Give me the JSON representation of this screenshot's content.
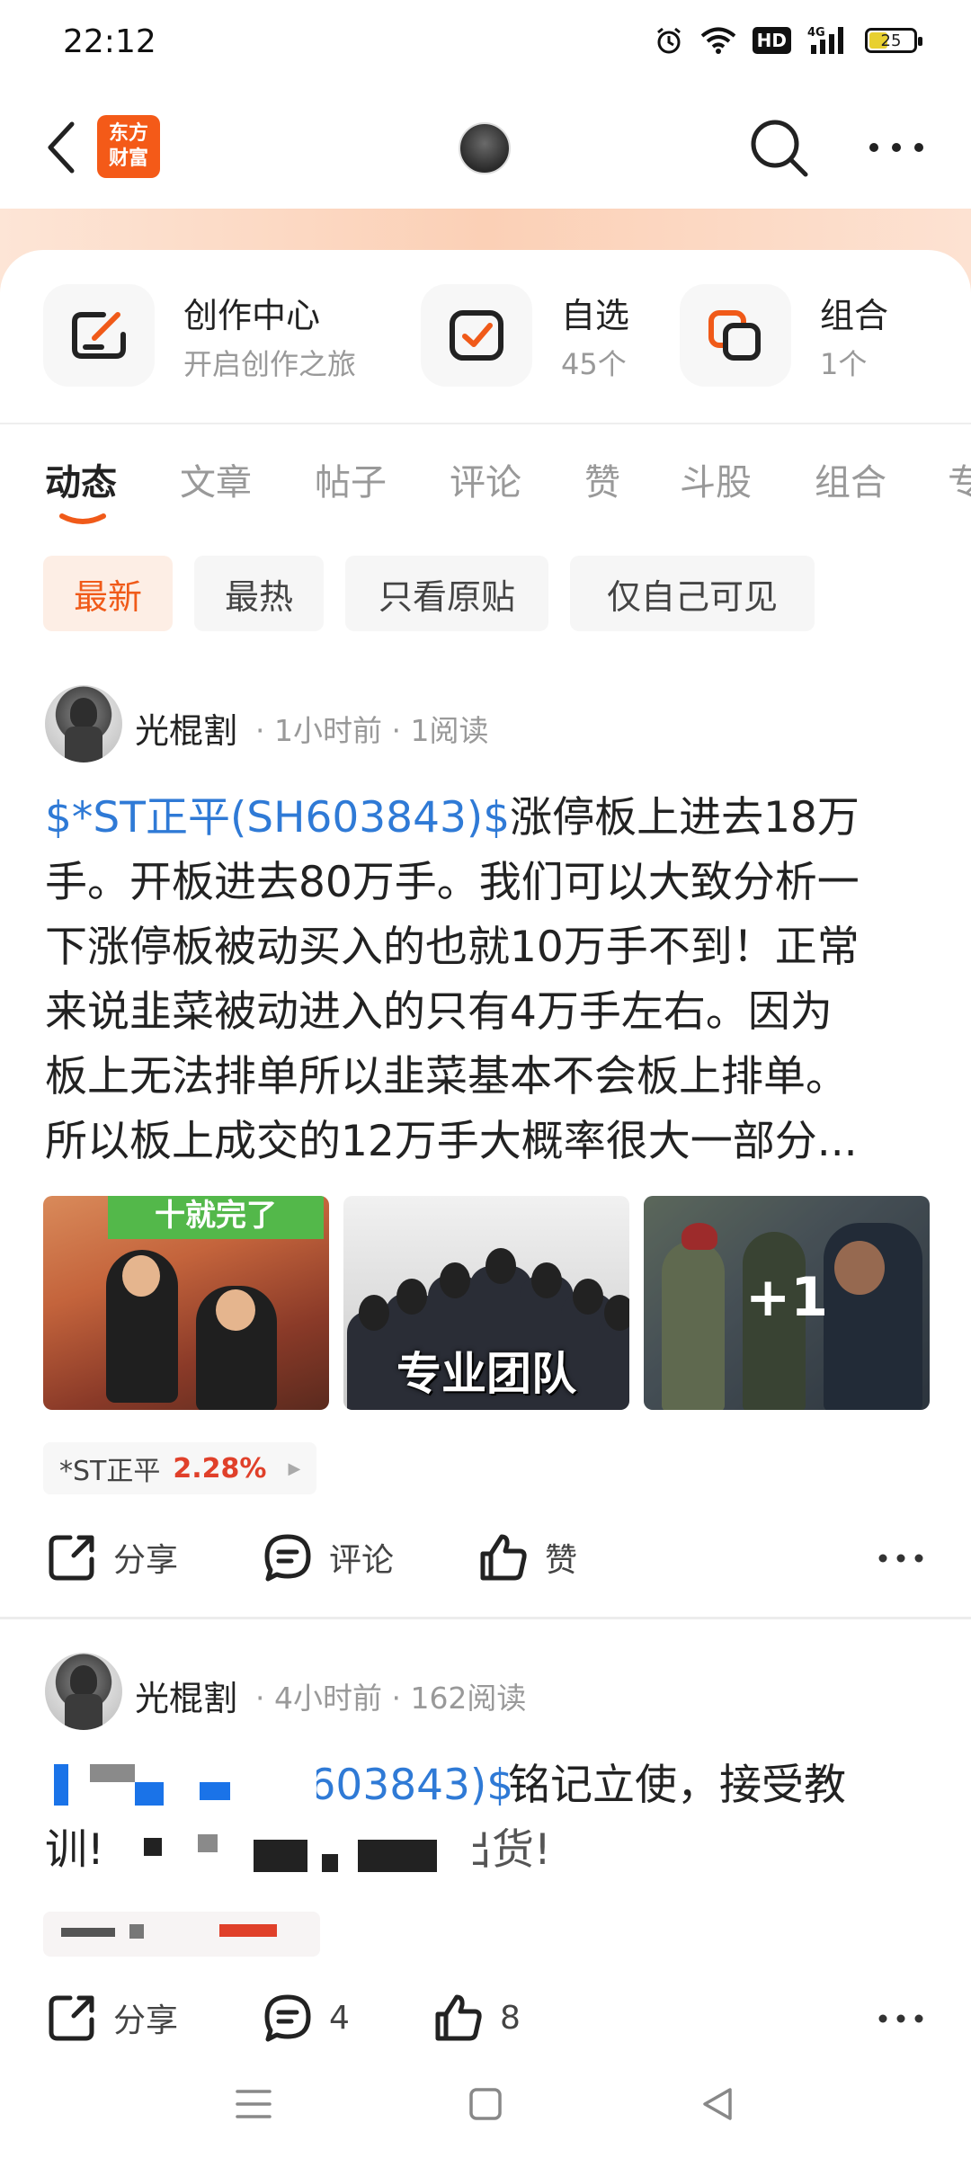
{
  "status_bar": {
    "time": "22:12",
    "hd": "HD",
    "network": "4G",
    "battery": "25"
  },
  "nav": {
    "logo_line1": "东方",
    "logo_line2": "财富",
    "back_icon": "chevron-left-icon",
    "search_icon": "search-icon",
    "more_icon": "more-horizontal-icon"
  },
  "quick": [
    {
      "title": "创作中心",
      "sub": "开启创作之旅",
      "icon": "edit-icon"
    },
    {
      "title": "自选",
      "sub": "45个",
      "icon": "checkbox-icon"
    },
    {
      "title": "组合",
      "sub": "1个",
      "icon": "portfolio-icon"
    }
  ],
  "tabs": [
    "动态",
    "文章",
    "帖子",
    "评论",
    "赞",
    "斗股",
    "组合",
    "专"
  ],
  "chips": [
    "最新",
    "最热",
    "只看原贴",
    "仅自己可见"
  ],
  "colors": {
    "accent": "#f05a19",
    "link": "#2f7ad6",
    "up": "#e0402a"
  },
  "post1": {
    "author": "光棍割",
    "meta": "· 1小时前 · 1阅读",
    "stock_link": "$*ST正平(SH603843)$",
    "line1_rest": "涨停板上进去18万",
    "line2": "手。开板进去80万手。我们可以大致分析一",
    "line3": "下涨停板被动买入的也就10万手不到！正常",
    "line4": "来说韭菜被动进入的只有4万手左右。因为",
    "line5": "板上无法排单所以韭菜基本不会板上排单。",
    "line6": "所以板上成交的12万手大概率很大一部分...",
    "thumb1_ribbon": "十就完了",
    "thumb2_caption": "专业团队",
    "more_images": "+1",
    "stock_name": "*ST正平",
    "stock_change": "2.28%",
    "share": "分享",
    "comment": "评论",
    "like": "赞"
  },
  "post2": {
    "author": "光棍割",
    "meta": "· 4小时前 · 162阅读",
    "line1_visible": "(SH603843)$",
    "line1_rest": "铭记立使，接受教",
    "line2_start": "训!",
    "line2_end": "出货!",
    "share": "分享",
    "comments": "4",
    "likes": "8"
  }
}
